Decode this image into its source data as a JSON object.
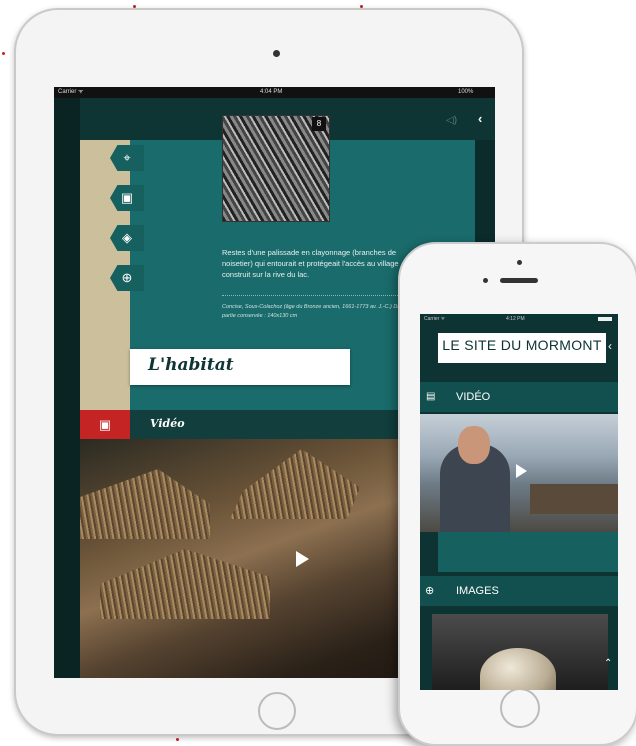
{
  "tablet": {
    "status": {
      "carrier": "Carrier ᯤ",
      "time": "4:04 PM",
      "battery": "100%"
    },
    "page_title": "L'habitat",
    "image_badge": "8",
    "description": "Restes d'une palissade en clayonnage (branches de noisetier) qui entourait et protégeait l'accès au village construit sur la rive du lac.",
    "caption": "Concise, Sous-Colachoz (âge du Bronze ancien, 1661-1773 av. J.-C.) Dimensions de la partie conservée : 140x130 cm",
    "video_label": "Vidéo",
    "side_icons": [
      "pin-icon",
      "camera-icon",
      "layers-icon",
      "plus-icon"
    ]
  },
  "phone": {
    "status": {
      "carrier": "Carrier ᯤ",
      "time": "4:12 PM"
    },
    "header_title": "LE SITE DU MORMONT",
    "sections": {
      "video": "VIDÉO",
      "images": "IMAGES"
    }
  },
  "colors": {
    "teal": "#1a6b6b",
    "dark_teal": "#0d3333",
    "red": "#c42424",
    "beige": "#cbbf9c"
  }
}
